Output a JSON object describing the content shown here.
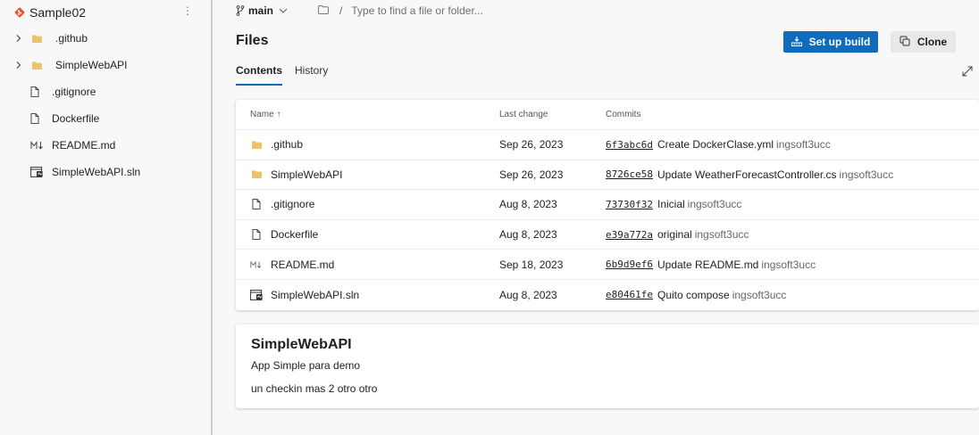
{
  "repo": {
    "name": "Sample02",
    "more": "⋮",
    "accent": "#e8552a"
  },
  "sidebar": {
    "items": [
      {
        "label": ".github",
        "type": "folder",
        "expandable": true
      },
      {
        "label": "SimpleWebAPI",
        "type": "folder",
        "expandable": true
      },
      {
        "label": ".gitignore",
        "type": "file"
      },
      {
        "label": "Dockerfile",
        "type": "file"
      },
      {
        "label": "README.md",
        "type": "markdown"
      },
      {
        "label": "SimpleWebAPI.sln",
        "type": "solution"
      }
    ]
  },
  "topbar": {
    "branch": "main",
    "path_hint": "Type to find a file or folder...",
    "separator": "/"
  },
  "page": {
    "title": "Files"
  },
  "actions": {
    "setup_build": "Set up build",
    "clone": "Clone"
  },
  "tabs": [
    {
      "label": "Contents",
      "active": true
    },
    {
      "label": "History",
      "active": false
    }
  ],
  "table": {
    "headers": {
      "name": "Name ↑",
      "last_change": "Last change",
      "commits": "Commits"
    },
    "rows": [
      {
        "name": ".github",
        "type": "folder",
        "last_change": "Sep 26, 2023",
        "hash": "6f3abc6d",
        "message": "Create DockerClase.yml",
        "author": "ingsoft3ucc"
      },
      {
        "name": "SimpleWebAPI",
        "type": "folder",
        "last_change": "Sep 26, 2023",
        "hash": "8726ce58",
        "message": "Update WeatherForecastController.cs",
        "author": "ingsoft3ucc"
      },
      {
        "name": ".gitignore",
        "type": "file",
        "last_change": "Aug 8, 2023",
        "hash": "73730f32",
        "message": "Inicial",
        "author": "ingsoft3ucc"
      },
      {
        "name": "Dockerfile",
        "type": "file",
        "last_change": "Aug 8, 2023",
        "hash": "e39a772a",
        "message": "original",
        "author": "ingsoft3ucc"
      },
      {
        "name": "README.md",
        "type": "markdown",
        "last_change": "Sep 18, 2023",
        "hash": "6b9d9ef6",
        "message": "Update README.md",
        "author": "ingsoft3ucc"
      },
      {
        "name": "SimpleWebAPI.sln",
        "type": "solution",
        "last_change": "Aug 8, 2023",
        "hash": "e80461fe",
        "message": "Quito compose",
        "author": "ingsoft3ucc"
      }
    ]
  },
  "readme": {
    "title": "SimpleWebAPI",
    "lines": [
      "App Simple para demo",
      "un checkin mas 2 otro otro"
    ]
  },
  "colors": {
    "primary": "#0f6cbd",
    "folder": "#e8c56a"
  }
}
